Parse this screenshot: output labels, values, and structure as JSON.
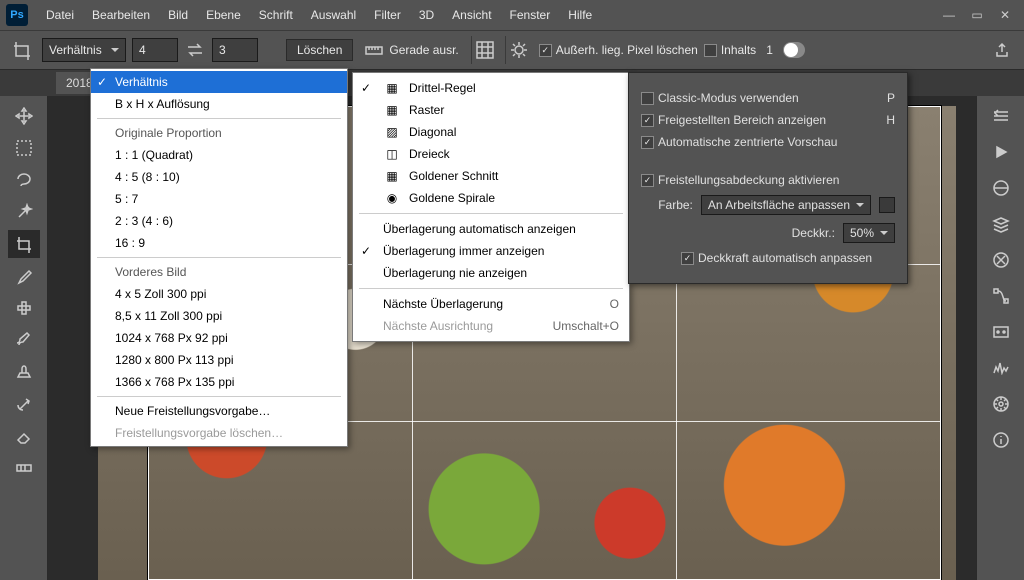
{
  "app": {
    "logo": "Ps"
  },
  "menubar": [
    "Datei",
    "Bearbeiten",
    "Bild",
    "Ebene",
    "Schrift",
    "Auswahl",
    "Filter",
    "3D",
    "Ansicht",
    "Fenster",
    "Hilfe"
  ],
  "options": {
    "ratio_label": "Verhältnis",
    "w": "4",
    "h": "3",
    "clear": "Löschen",
    "straighten": "Gerade ausr.",
    "delete_cropped": "Außerh. lieg. Pixel löschen",
    "content_aware": "Inhalts",
    "count": "1"
  },
  "tab": "2018 … (Fre",
  "ratio_menu": {
    "selected": "Verhältnis",
    "item_bxh": "B x H x Auflösung",
    "hdr_orig": "Originale Proportion",
    "r11": "1 : 1 (Quadrat)",
    "r45": "4 : 5 (8 : 10)",
    "r57": "5 : 7",
    "r23": "2 : 3 (4 : 6)",
    "r169": "16 : 9",
    "hdr_front": "Vorderes Bild",
    "p1": "4 x 5 Zoll 300 ppi",
    "p2": "8,5 x 11 Zoll 300 ppi",
    "p3": "1024 x 768 Px 92 ppi",
    "p4": "1280 x 800 Px 113 ppi",
    "p5": "1366 x 768 Px 135 ppi",
    "new_preset": "Neue Freistellungsvorgabe…",
    "del_preset": "Freistellungsvorgabe löschen…"
  },
  "overlay_menu": {
    "thirds": "Drittel-Regel",
    "grid": "Raster",
    "diagonal": "Diagonal",
    "triangle": "Dreieck",
    "golden": "Goldener Schnitt",
    "spiral": "Goldene Spirale",
    "auto_show": "Überlagerung automatisch anzeigen",
    "always_show": "Überlagerung immer anzeigen",
    "never_show": "Überlagerung nie anzeigen",
    "next_overlay": "Nächste Überlagerung",
    "next_overlay_sc": "O",
    "next_orient": "Nächste Ausrichtung",
    "next_orient_sc": "Umschalt+O"
  },
  "settings": {
    "classic": "Classic-Modus verwenden",
    "classic_sc": "P",
    "show_cropped": "Freigestellten Bereich anzeigen",
    "show_cropped_sc": "H",
    "auto_center": "Automatische zentrierte Vorschau",
    "enable_shield": "Freistellungsabdeckung aktivieren",
    "color_label": "Farbe:",
    "color_value": "An Arbeitsfläche anpassen",
    "opacity_label": "Deckkr.:",
    "opacity_value": "50%",
    "auto_opacity": "Deckkraft automatisch anpassen"
  }
}
